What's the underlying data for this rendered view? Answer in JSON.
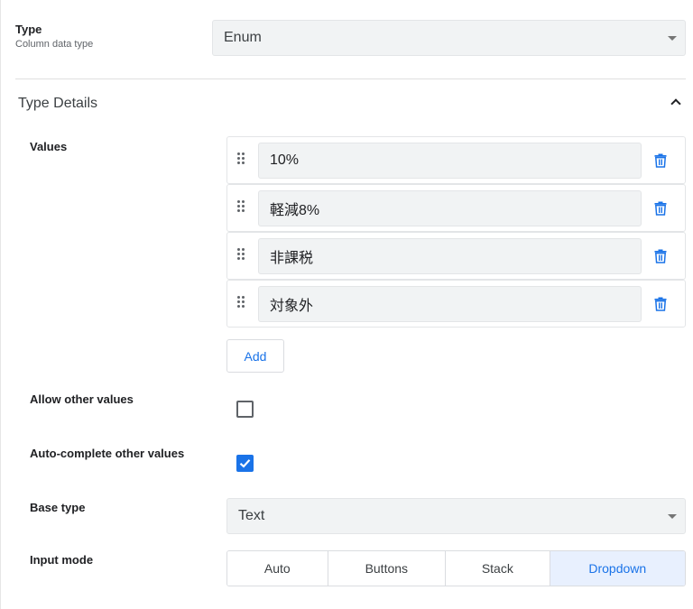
{
  "type_field": {
    "label": "Type",
    "sublabel": "Column data type",
    "value": "Enum"
  },
  "type_details": {
    "title": "Type Details",
    "values_label": "Values",
    "values": [
      "10%",
      "軽減8%",
      "非課税",
      "対象外"
    ],
    "add_label": "Add"
  },
  "allow_other": {
    "label": "Allow other values",
    "checked": false
  },
  "autocomplete_other": {
    "label": "Auto-complete other values",
    "checked": true
  },
  "base_type": {
    "label": "Base type",
    "value": "Text"
  },
  "input_mode": {
    "label": "Input mode",
    "options": [
      "Auto",
      "Buttons",
      "Stack",
      "Dropdown"
    ],
    "selected": "Dropdown"
  },
  "colors": {
    "accent": "#1a73e8",
    "field_bg": "#f1f3f4",
    "selected_bg": "#e8f0fe"
  }
}
